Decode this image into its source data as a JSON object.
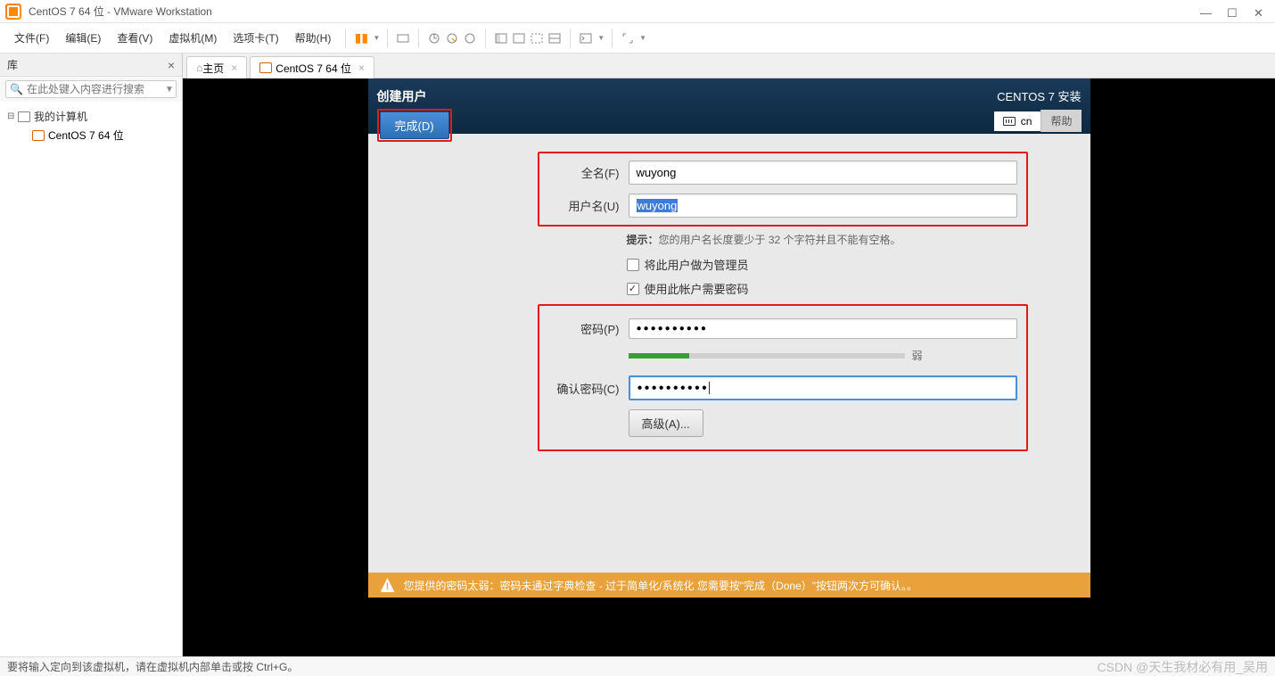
{
  "window": {
    "title": "CentOS 7 64 位 - VMware Workstation"
  },
  "menu": {
    "file": "文件(F)",
    "edit": "编辑(E)",
    "view": "查看(V)",
    "vm": "虚拟机(M)",
    "tabs": "选项卡(T)",
    "help": "帮助(H)"
  },
  "sidebar": {
    "title": "库",
    "search_placeholder": "在此处键入内容进行搜索",
    "root": "我的计算机",
    "vm": "CentOS 7 64 位"
  },
  "tabs": {
    "home": "主页",
    "vm": "CentOS 7 64 位"
  },
  "installer": {
    "title": "创建用户",
    "done": "完成(D)",
    "product": "CENTOS 7 安装",
    "lang": "cn",
    "help": "帮助",
    "fullname_label": "全名(F)",
    "fullname_value": "wuyong",
    "username_label": "用户名(U)",
    "username_value": "wuyong",
    "hint_prefix": "提示：",
    "hint": "您的用户名长度要少于 32 个字符并且不能有空格。",
    "admin_checkbox": "将此用户做为管理员",
    "require_pw_checkbox": "使用此帐户需要密码",
    "password_label": "密码(P)",
    "password_value": "●●●●●●●●●●",
    "strength_label": "弱",
    "confirm_label": "确认密码(C)",
    "confirm_value": "●●●●●●●●●●",
    "advanced": "高级(A)...",
    "warning": "您提供的密码太弱：密码未通过字典检查 - 过于简单化/系统化 您需要按\"完成（Done）\"按钮两次方可确认。。"
  },
  "statusbar": {
    "text": "要将输入定向到该虚拟机，请在虚拟机内部单击或按 Ctrl+G。",
    "watermark": "CSDN @天生我材必有用_吴用"
  }
}
